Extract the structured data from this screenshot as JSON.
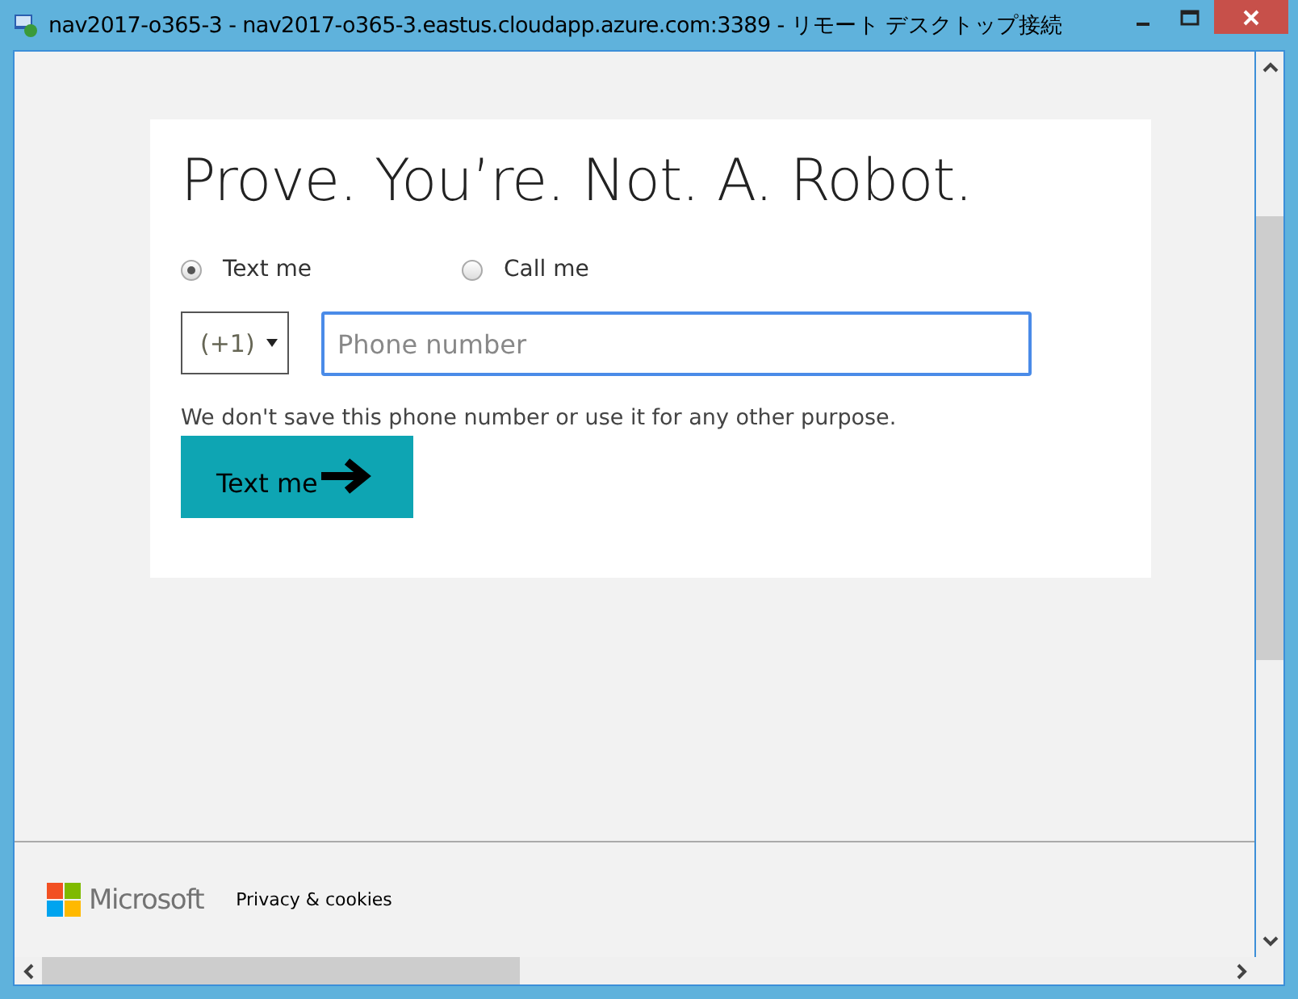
{
  "window": {
    "title": "nav2017-o365-3 - nav2017-o365-3.eastus.cloudapp.azure.com:3389 - リモート デスクトップ接続"
  },
  "heading": "Prove. You’re. Not. A. Robot.",
  "options": [
    {
      "label": "Text me",
      "selected": true
    },
    {
      "label": "Call me",
      "selected": false
    }
  ],
  "country_code": "(+1)",
  "phone": {
    "placeholder": "Phone number"
  },
  "note": "We don't save this phone number or use it for any other purpose.",
  "submit": "Text me",
  "footer": {
    "brand": "Microsoft",
    "privacy_link": "Privacy & cookies"
  }
}
